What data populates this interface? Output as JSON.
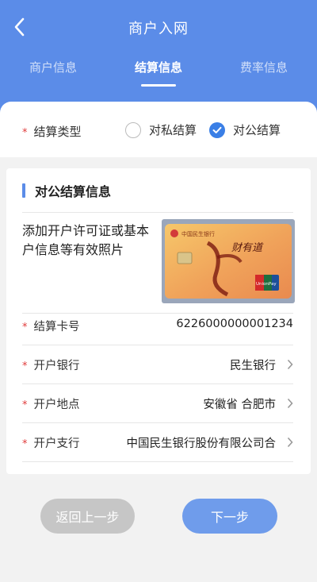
{
  "header": {
    "title": "商户入网",
    "tabs": [
      {
        "label": "商户信息",
        "active": false
      },
      {
        "label": "结算信息",
        "active": true
      },
      {
        "label": "费率信息",
        "active": false
      }
    ]
  },
  "settlement_type": {
    "label": "结算类型",
    "options": [
      {
        "label": "对私结算",
        "checked": false
      },
      {
        "label": "对公结算",
        "checked": true
      }
    ]
  },
  "section": {
    "title": "对公结算信息",
    "upload_prompt": "添加开户许可证或基本户信息等有效照片",
    "card_image": {
      "bank_name_text": "中国民生银行",
      "card_slogan": "财有道",
      "card_network": "UnionPay"
    },
    "fields": [
      {
        "label": "结算卡号",
        "value": "6226000000001234"
      },
      {
        "label": "开户银行",
        "value": "民生银行"
      },
      {
        "label": "开户地点",
        "value": "安徽省 合肥市"
      },
      {
        "label": "开户支行",
        "value": "中国民生银行股份有限公司合"
      }
    ]
  },
  "buttons": {
    "back": "返回上一步",
    "next": "下一步"
  },
  "colors": {
    "header": "#5b8ce8",
    "accent": "#3a7fe6",
    "required": "#e03b3b"
  }
}
